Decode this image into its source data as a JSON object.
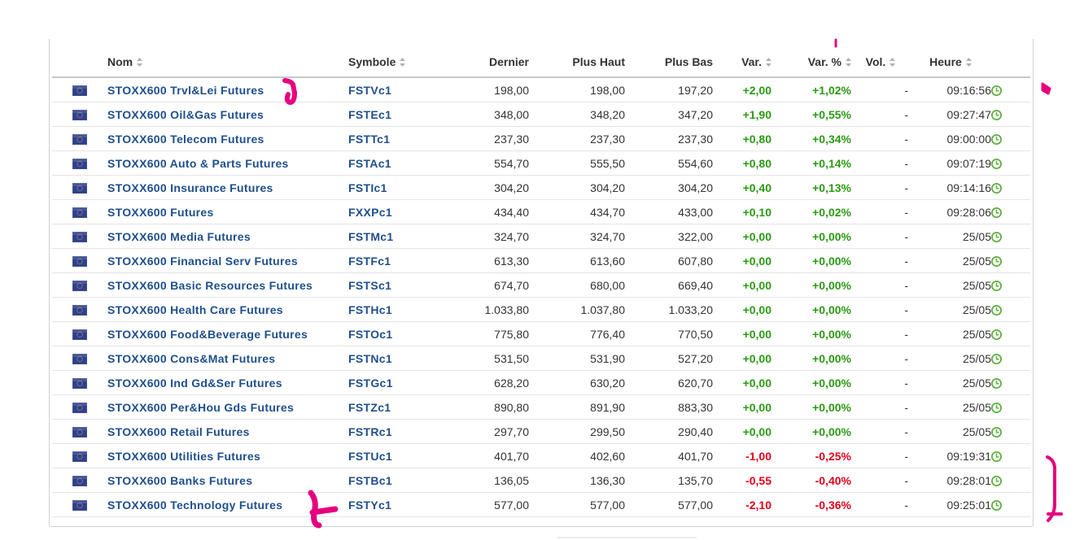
{
  "table": {
    "columns": [
      {
        "key": "flag",
        "label": "",
        "sortable": false
      },
      {
        "key": "name",
        "label": "Nom",
        "sortable": true
      },
      {
        "key": "symbol",
        "label": "Symbole",
        "sortable": true
      },
      {
        "key": "last",
        "label": "Dernier",
        "sortable": false
      },
      {
        "key": "high",
        "label": "Plus Haut",
        "sortable": false
      },
      {
        "key": "low",
        "label": "Plus Bas",
        "sortable": false
      },
      {
        "key": "change",
        "label": "Var.",
        "sortable": true
      },
      {
        "key": "change_pct",
        "label": "Var. %",
        "sortable": true
      },
      {
        "key": "volume",
        "label": "Vol.",
        "sortable": true
      },
      {
        "key": "time",
        "label": "Heure",
        "sortable": true
      },
      {
        "key": "clock",
        "label": "",
        "sortable": false
      }
    ],
    "rows": [
      {
        "name": "STOXX600 Trvl&Lei Futures",
        "symbol": "FSTVc1",
        "last": "198,00",
        "high": "198,00",
        "low": "197,20",
        "change": "+2,00",
        "change_pct": "+1,02%",
        "volume": "-",
        "time": "09:16:56",
        "direction": "pos"
      },
      {
        "name": "STOXX600 Oil&Gas Futures",
        "symbol": "FSTEc1",
        "last": "348,00",
        "high": "348,20",
        "low": "347,20",
        "change": "+1,90",
        "change_pct": "+0,55%",
        "volume": "-",
        "time": "09:27:47",
        "direction": "pos"
      },
      {
        "name": "STOXX600 Telecom Futures",
        "symbol": "FSTTc1",
        "last": "237,30",
        "high": "237,30",
        "low": "237,30",
        "change": "+0,80",
        "change_pct": "+0,34%",
        "volume": "-",
        "time": "09:00:00",
        "direction": "pos"
      },
      {
        "name": "STOXX600 Auto & Parts Futures",
        "symbol": "FSTAc1",
        "last": "554,70",
        "high": "555,50",
        "low": "554,60",
        "change": "+0,80",
        "change_pct": "+0,14%",
        "volume": "-",
        "time": "09:07:19",
        "direction": "pos"
      },
      {
        "name": "STOXX600 Insurance Futures",
        "symbol": "FSTIc1",
        "last": "304,20",
        "high": "304,20",
        "low": "304,20",
        "change": "+0,40",
        "change_pct": "+0,13%",
        "volume": "-",
        "time": "09:14:16",
        "direction": "pos"
      },
      {
        "name": "STOXX600 Futures",
        "symbol": "FXXPc1",
        "last": "434,40",
        "high": "434,70",
        "low": "433,00",
        "change": "+0,10",
        "change_pct": "+0,02%",
        "volume": "-",
        "time": "09:28:06",
        "direction": "pos"
      },
      {
        "name": "STOXX600 Media Futures",
        "symbol": "FSTMc1",
        "last": "324,70",
        "high": "324,70",
        "low": "322,00",
        "change": "+0,00",
        "change_pct": "+0,00%",
        "volume": "-",
        "time": "25/05",
        "direction": "pos"
      },
      {
        "name": "STOXX600 Financial Serv Futures",
        "symbol": "FSTFc1",
        "last": "613,30",
        "high": "613,60",
        "low": "607,80",
        "change": "+0,00",
        "change_pct": "+0,00%",
        "volume": "-",
        "time": "25/05",
        "direction": "pos"
      },
      {
        "name": "STOXX600 Basic Resources Futures",
        "symbol": "FSTSc1",
        "last": "674,70",
        "high": "680,00",
        "low": "669,40",
        "change": "+0,00",
        "change_pct": "+0,00%",
        "volume": "-",
        "time": "25/05",
        "direction": "pos"
      },
      {
        "name": "STOXX600 Health Care Futures",
        "symbol": "FSTHc1",
        "last": "1.033,80",
        "high": "1.037,80",
        "low": "1.033,20",
        "change": "+0,00",
        "change_pct": "+0,00%",
        "volume": "-",
        "time": "25/05",
        "direction": "pos"
      },
      {
        "name": "STOXX600 Food&Beverage Futures",
        "symbol": "FSTOc1",
        "last": "775,80",
        "high": "776,40",
        "low": "770,50",
        "change": "+0,00",
        "change_pct": "+0,00%",
        "volume": "-",
        "time": "25/05",
        "direction": "pos"
      },
      {
        "name": "STOXX600 Cons&Mat Futures",
        "symbol": "FSTNc1",
        "last": "531,50",
        "high": "531,90",
        "low": "527,20",
        "change": "+0,00",
        "change_pct": "+0,00%",
        "volume": "-",
        "time": "25/05",
        "direction": "pos"
      },
      {
        "name": "STOXX600 Ind Gd&Ser Futures",
        "symbol": "FSTGc1",
        "last": "628,20",
        "high": "630,20",
        "low": "620,70",
        "change": "+0,00",
        "change_pct": "+0,00%",
        "volume": "-",
        "time": "25/05",
        "direction": "pos"
      },
      {
        "name": "STOXX600 Per&Hou Gds Futures",
        "symbol": "FSTZc1",
        "last": "890,80",
        "high": "891,90",
        "low": "883,30",
        "change": "+0,00",
        "change_pct": "+0,00%",
        "volume": "-",
        "time": "25/05",
        "direction": "pos"
      },
      {
        "name": "STOXX600 Retail Futures",
        "symbol": "FSTRc1",
        "last": "297,70",
        "high": "299,50",
        "low": "290,40",
        "change": "+0,00",
        "change_pct": "+0,00%",
        "volume": "-",
        "time": "25/05",
        "direction": "pos"
      },
      {
        "name": "STOXX600 Utilities Futures",
        "symbol": "FSTUc1",
        "last": "401,70",
        "high": "402,60",
        "low": "401,70",
        "change": "-1,00",
        "change_pct": "-0,25%",
        "volume": "-",
        "time": "09:19:31",
        "direction": "neg"
      },
      {
        "name": "STOXX600 Banks Futures",
        "symbol": "FSTBc1",
        "last": "136,05",
        "high": "136,30",
        "low": "135,70",
        "change": "-0,55",
        "change_pct": "-0,40%",
        "volume": "-",
        "time": "09:28:01",
        "direction": "neg"
      },
      {
        "name": "STOXX600 Technology Futures",
        "symbol": "FSTYc1",
        "last": "577,00",
        "high": "577,00",
        "low": "577,00",
        "change": "-2,10",
        "change_pct": "-0,36%",
        "volume": "-",
        "time": "09:25:01",
        "direction": "neg"
      }
    ]
  },
  "colors": {
    "link": "#1f4f8c",
    "positive": "#2b9a14",
    "negative": "#e3001b",
    "annotation": "#e6007e",
    "clock": "#5fb041"
  },
  "icons": {
    "row_flag": "eu-flag-icon",
    "row_time": "clock-icon",
    "sort": "sort-arrows-icon"
  }
}
